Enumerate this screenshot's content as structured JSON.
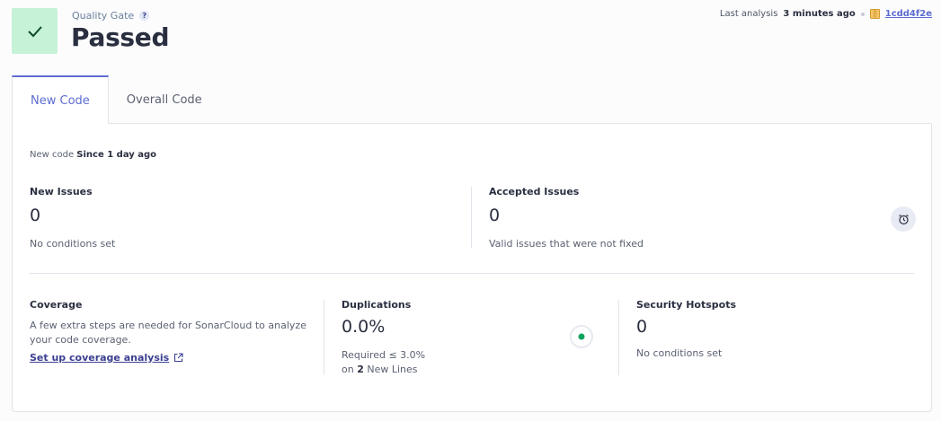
{
  "quality_gate": {
    "label": "Quality Gate",
    "help": "?",
    "status": "Passed",
    "status_color": "#c6f2d7"
  },
  "analysis": {
    "prefix": "Last analysis",
    "time": "3 minutes ago",
    "commit": "1cdd4f2e"
  },
  "tabs": [
    {
      "label": "New Code",
      "active": true
    },
    {
      "label": "Overall Code",
      "active": false
    }
  ],
  "new_code": {
    "prefix": "New code",
    "value": "Since 1 day ago"
  },
  "new_issues": {
    "title": "New Issues",
    "value": "0",
    "sub": "No conditions set"
  },
  "accepted_issues": {
    "title": "Accepted Issues",
    "value": "0",
    "sub": "Valid issues that were not fixed"
  },
  "coverage": {
    "title": "Coverage",
    "desc": "A few extra steps are needed for SonarCloud to analyze your code coverage.",
    "link": "Set up coverage analysis"
  },
  "duplications": {
    "title": "Duplications",
    "value": "0.0%",
    "required": "Required ≤ 3.0%",
    "on_prefix": "on",
    "lines_count": "2",
    "lines_suffix": "New Lines",
    "indicator_color": "#00aa00"
  },
  "security_hotspots": {
    "title": "Security Hotspots",
    "value": "0",
    "sub": "No conditions set"
  },
  "colors": {
    "accent": "#5d6cd0",
    "text": "#2a2f40"
  }
}
